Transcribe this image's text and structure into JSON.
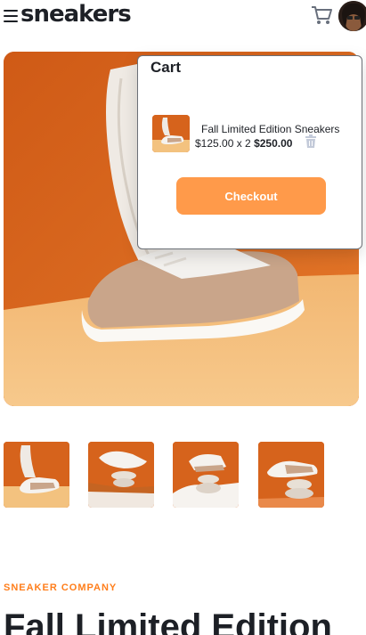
{
  "header": {
    "logo": "sneakers",
    "menu_icon": "hamburger-menu-icon",
    "cart_icon": "cart-icon",
    "avatar": "user-avatar"
  },
  "gallery": {
    "thumbnails": [
      {
        "name": "product-thumbnail-1"
      },
      {
        "name": "product-thumbnail-2"
      },
      {
        "name": "product-thumbnail-3"
      },
      {
        "name": "product-thumbnail-4"
      }
    ]
  },
  "product": {
    "company": "SNEAKER COMPANY",
    "title": "Fall Limited Edition"
  },
  "cart": {
    "title": "Cart",
    "item": {
      "name": "Fall Limited Edition Sneakers",
      "price_line": "$125.00 x 2",
      "total": "$250.00"
    },
    "checkout_label": "Checkout",
    "delete_icon": "trash-icon"
  },
  "colors": {
    "accent": "#ff7e1b",
    "checkout": "#ff9a4a",
    "text": "#1d2026",
    "muted": "#b6bcc8"
  }
}
